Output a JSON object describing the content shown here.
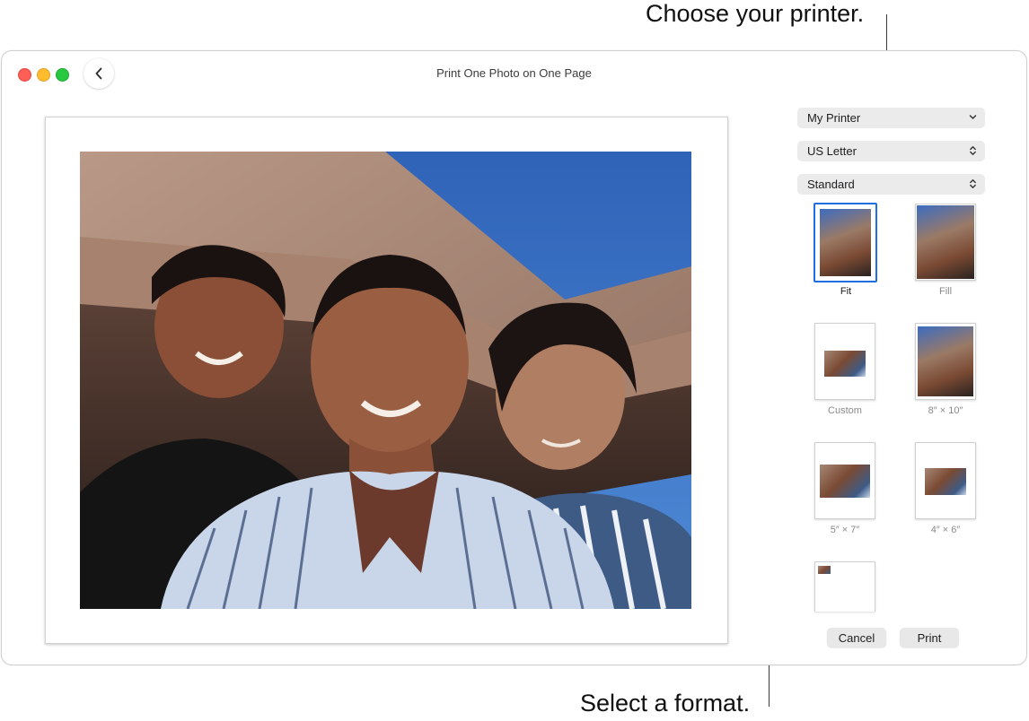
{
  "callouts": {
    "printer": "Choose your printer.",
    "format": "Select a format."
  },
  "window": {
    "title": "Print One Photo on One Page"
  },
  "settings": {
    "printer": "My Printer",
    "paper_size": "US Letter",
    "quality": "Standard"
  },
  "formats": [
    {
      "label": "Fit",
      "selected": true
    },
    {
      "label": "Fill",
      "selected": false
    },
    {
      "label": "Custom",
      "selected": false
    },
    {
      "label": "8″ × 10″",
      "selected": false
    },
    {
      "label": "5″ × 7″",
      "selected": false
    },
    {
      "label": "4″ × 6″",
      "selected": false
    }
  ],
  "buttons": {
    "cancel": "Cancel",
    "print": "Print"
  },
  "colors": {
    "accent": "#1f6fe0",
    "close": "#ff5f57",
    "minimize": "#febc2e",
    "zoom": "#28c840"
  },
  "icons": [
    "chevron-left-icon",
    "chevron-down-icon",
    "up-down-chevron-icon"
  ]
}
